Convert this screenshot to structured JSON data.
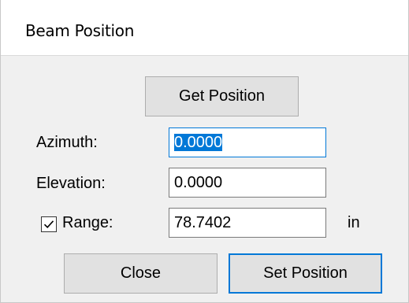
{
  "window": {
    "title": "Beam Position"
  },
  "buttons": {
    "get_position": "Get Position",
    "close": "Close",
    "set_position": "Set Position"
  },
  "fields": {
    "azimuth": {
      "label": "Azimuth:",
      "value": "0.0000"
    },
    "elevation": {
      "label": "Elevation:",
      "value": "0.0000"
    },
    "range": {
      "label": "Range:",
      "value": "78.7402",
      "unit": "in",
      "checked": true
    }
  },
  "icons": {
    "range_checkbox": "checkmark-icon"
  },
  "colors": {
    "accent": "#0078d7",
    "button_bg": "#e1e1e1",
    "dialog_bg": "#f0f0f0"
  }
}
